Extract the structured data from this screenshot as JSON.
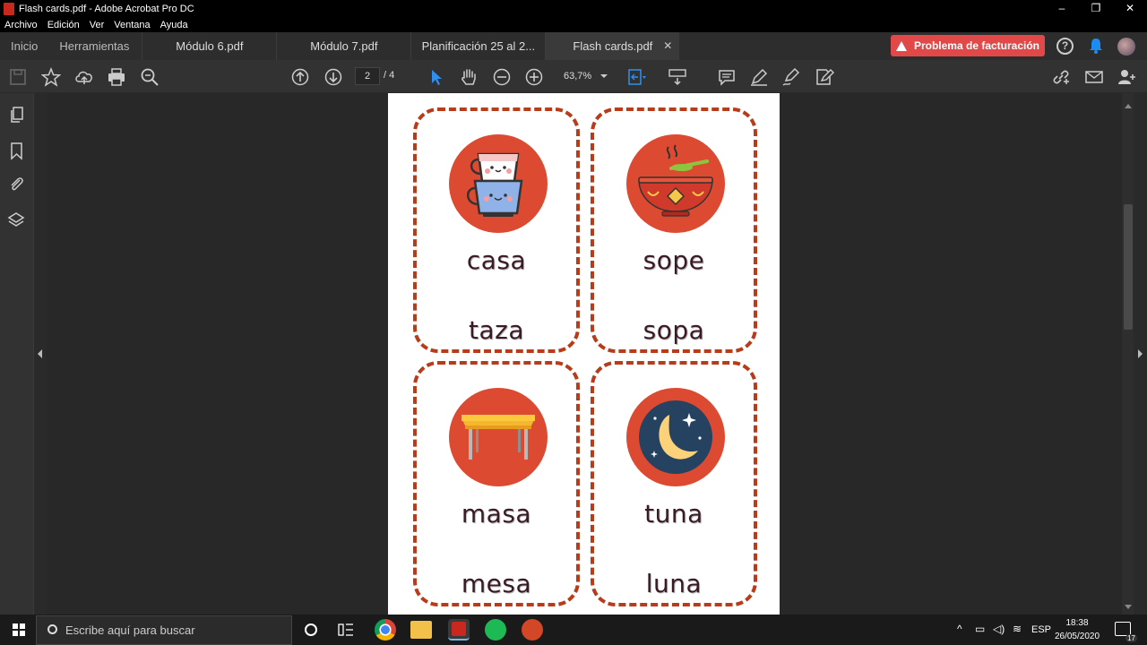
{
  "window": {
    "title": "Flash cards.pdf - Adobe Acrobat Pro DC",
    "controls": [
      "–",
      "❐",
      "✕"
    ]
  },
  "menu": [
    "Archivo",
    "Edición",
    "Ver",
    "Ventana",
    "Ayuda"
  ],
  "nav_tabs": [
    "Inicio",
    "Herramientas"
  ],
  "doc_tabs": [
    "Módulo 6.pdf",
    "Módulo 7.pdf",
    "Planificación 25 al 2...",
    "Flash cards.pdf"
  ],
  "alert_button": "Problema de facturación",
  "help_label": "?",
  "toolbar": {
    "page_current": "2",
    "page_total": "/ 4",
    "zoom": "63,7%"
  },
  "cards": [
    {
      "word1": "casa",
      "word2": "taza",
      "icon": "cups-icon"
    },
    {
      "word1": "sope",
      "word2": "sopa",
      "icon": "soup-bowl-icon"
    },
    {
      "word1": "masa",
      "word2": "mesa",
      "icon": "table-icon"
    },
    {
      "word1": "tuna",
      "word2": "luna",
      "icon": "moon-icon"
    }
  ],
  "taskbar": {
    "search_placeholder": "Escribe aquí para buscar",
    "language": "ESP",
    "time": "18:38",
    "date": "26/05/2020",
    "notification_count": "17"
  },
  "colors": {
    "card_border": "#b83b1a",
    "icon_circle": "#dd4a32",
    "alert": "#e04948"
  }
}
